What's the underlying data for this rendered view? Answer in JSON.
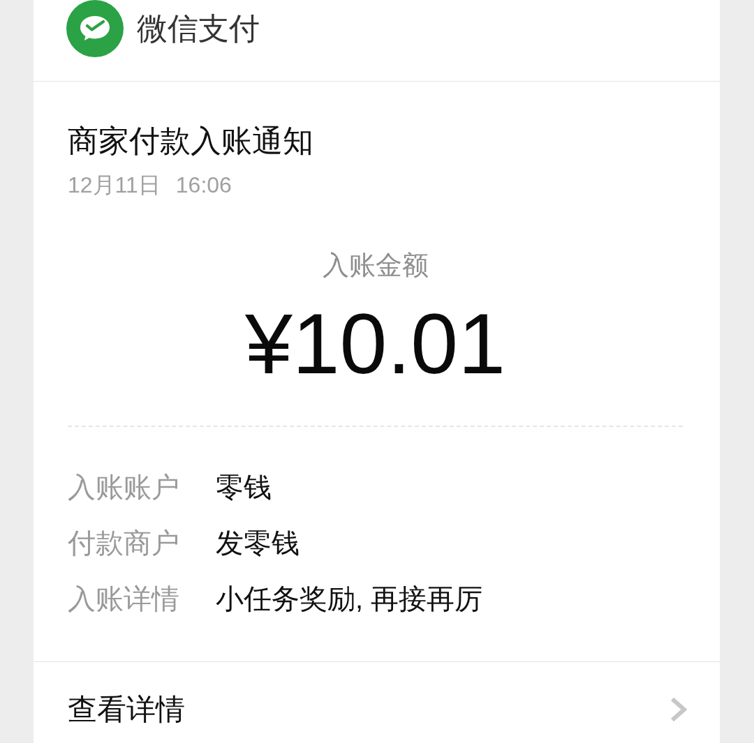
{
  "header": {
    "title": "微信支付"
  },
  "notice": {
    "title": "商家付款入账通知",
    "date": "12月11日",
    "time": "16:06"
  },
  "amount": {
    "label": "入账金额",
    "value": "¥10.01"
  },
  "details": [
    {
      "label": "入账账户",
      "value": "零钱"
    },
    {
      "label": "付款商户",
      "value": "发零钱"
    },
    {
      "label": "入账详情",
      "value": "小任务奖励, 再接再厉"
    }
  ],
  "footer": {
    "link": "查看详情"
  }
}
